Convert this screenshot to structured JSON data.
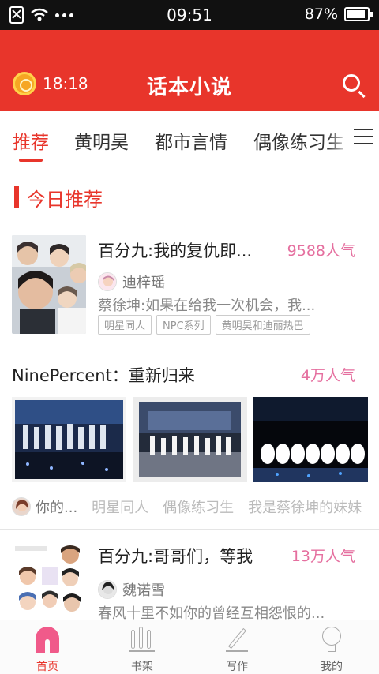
{
  "status_bar": {
    "time": "09:51",
    "battery": "87%",
    "icons": [
      "sim-icon",
      "wifi-icon",
      "more-dots-icon",
      "battery-icon"
    ]
  },
  "header": {
    "timer": "18:18",
    "title": "话本小说",
    "icons": [
      "alarm-coin-icon",
      "search-icon"
    ],
    "brand_color": "#e8352b"
  },
  "tabs": {
    "items": [
      "推荐",
      "黄明昊",
      "都市言情",
      "偶像练习生"
    ],
    "active": "推荐",
    "menu_icon": "menu-icon"
  },
  "section": {
    "title": "今日推荐"
  },
  "books": [
    {
      "title": "百分九:我的复仇即...",
      "popularity": "9588人气",
      "author": "迪梓瑶",
      "excerpt": "蔡徐坤:如果在给我一次机会，我...",
      "tags": [
        "明星同人",
        "NPC系列",
        "黄明昊和迪丽热巴"
      ]
    },
    {
      "title": "百分九:哥哥们，等我",
      "popularity": "13万人气",
      "author": "魏诺雪",
      "excerpt": "春风十里不如你的曾经互相怨恨的..."
    }
  ],
  "topic": {
    "title": "NinePercent：重新归来",
    "popularity": "4万人气",
    "tags": [
      "你的...",
      "明星同人",
      "偶像练习生",
      "我是蔡徐坤的妹妹"
    ]
  },
  "bottom_nav": {
    "items": [
      {
        "label": "首页",
        "icon": "home-icon"
      },
      {
        "label": "书架",
        "icon": "bookshelf-icon"
      },
      {
        "label": "写作",
        "icon": "pen-icon"
      },
      {
        "label": "我的",
        "icon": "profile-icon"
      }
    ],
    "active": "首页"
  },
  "colors": {
    "accent": "#e8352b",
    "popularity": "#e56f9f"
  }
}
